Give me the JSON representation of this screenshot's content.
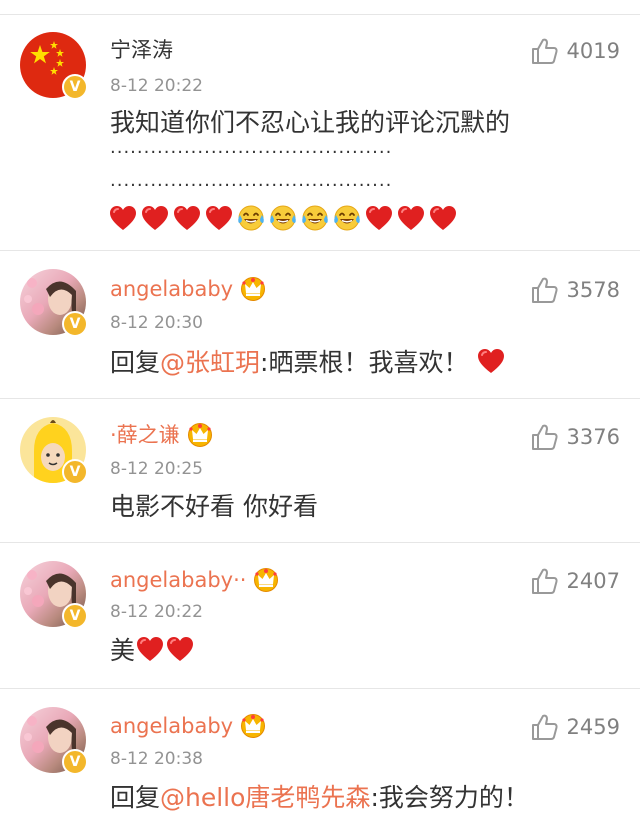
{
  "comments": [
    {
      "name": "宁泽涛",
      "time": "8-12 20:22",
      "likes": "4019",
      "text": "我知道你们不忍心让我的评论沉默的",
      "dots_1": "··········································",
      "dots_2": "··········································",
      "emoji": [
        "heart",
        "heart",
        "heart",
        "heart",
        "tears-of-joy",
        "tears-of-joy",
        "tears-of-joy",
        "tears-of-joy",
        "heart",
        "heart",
        "heart"
      ]
    },
    {
      "name": "angelababy",
      "time": "8-12 20:30",
      "likes": "3578",
      "reply_prefix": "回复",
      "mention": "@张虹玥",
      "text": ":晒票根！我喜欢！",
      "emoji": [
        "heart"
      ]
    },
    {
      "name": "·薛之谦",
      "time": "8-12 20:25",
      "likes": "3376",
      "text": "电影不好看 你好看"
    },
    {
      "name": "angelababy··",
      "time": "8-12 20:22",
      "likes": "2407",
      "text": "美",
      "emoji": [
        "heart",
        "heart"
      ]
    },
    {
      "name": "angelababy",
      "time": "8-12 20:38",
      "likes": "2459",
      "reply_prefix": "回复",
      "mention": "@hello唐老鸭先森",
      "text": ":我会努力的！"
    }
  ],
  "icons": {
    "like": "thumbs-up-icon",
    "verified": "verified-badge-icon",
    "vip": "crown-icon"
  },
  "colors": {
    "vip_name": "#eb7350",
    "verified_badge": "#f3b72b",
    "meta_text": "#939393"
  }
}
